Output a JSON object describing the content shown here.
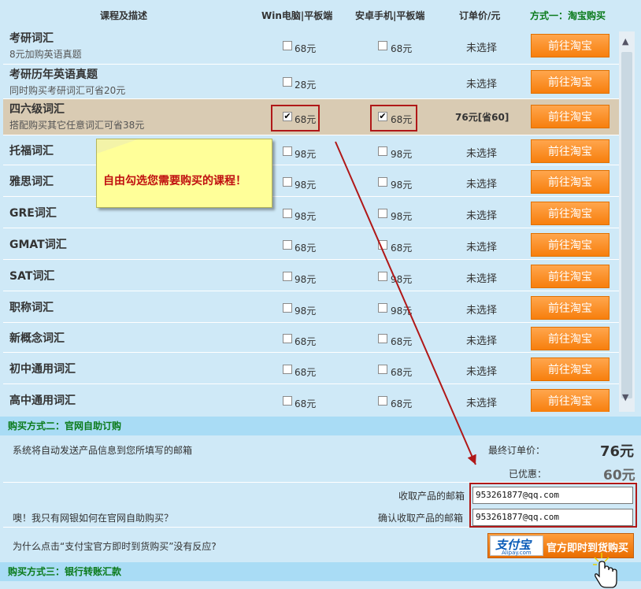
{
  "header": {
    "col_course": "课程及描述",
    "col_win": "Win电脑|平板端",
    "col_android": "安卓手机|平板端",
    "col_price": "订单价/元",
    "col_method": "方式一：淘宝购买"
  },
  "courses": [
    {
      "name": "考研词汇",
      "desc": "8元加购英语真题",
      "win_price": "68元",
      "win_checked": false,
      "android_price": "68元",
      "android_checked": false,
      "order": "未选择",
      "button": "前往淘宝"
    },
    {
      "name": "考研历年英语真题",
      "desc": "同时购买考研词汇可省20元",
      "win_price": "28元",
      "win_checked": false,
      "android_price": "",
      "android_checked": false,
      "order": "未选择",
      "button": "前往淘宝"
    },
    {
      "name": "四六级词汇",
      "desc": "搭配购买其它任意词汇可省38元",
      "win_price": "68元",
      "win_checked": true,
      "android_price": "68元",
      "android_checked": true,
      "order": "76元[省60]",
      "button": "前往淘宝"
    },
    {
      "name": "托福词汇",
      "desc": "",
      "win_price": "98元",
      "win_checked": false,
      "android_price": "98元",
      "android_checked": false,
      "order": "未选择",
      "button": "前往淘宝"
    },
    {
      "name": "雅思词汇",
      "desc": "",
      "win_price": "98元",
      "win_checked": false,
      "android_price": "98元",
      "android_checked": false,
      "order": "未选择",
      "button": "前往淘宝"
    },
    {
      "name": "GRE词汇",
      "desc": "",
      "win_price": "98元",
      "win_checked": false,
      "android_price": "98元",
      "android_checked": false,
      "order": "未选择",
      "button": "前往淘宝"
    },
    {
      "name": "GMAT词汇",
      "desc": "",
      "win_price": "68元",
      "win_checked": false,
      "android_price": "68元",
      "android_checked": false,
      "order": "未选择",
      "button": "前往淘宝"
    },
    {
      "name": "SAT词汇",
      "desc": "",
      "win_price": "98元",
      "win_checked": false,
      "android_price": "98元",
      "android_checked": false,
      "order": "未选择",
      "button": "前往淘宝"
    },
    {
      "name": "职称词汇",
      "desc": "",
      "win_price": "98元",
      "win_checked": false,
      "android_price": "98元",
      "android_checked": false,
      "order": "未选择",
      "button": "前往淘宝"
    },
    {
      "name": "新概念词汇",
      "desc": "",
      "win_price": "68元",
      "win_checked": false,
      "android_price": "68元",
      "android_checked": false,
      "order": "未选择",
      "button": "前往淘宝"
    },
    {
      "name": "初中通用词汇",
      "desc": "",
      "win_price": "68元",
      "win_checked": false,
      "android_price": "68元",
      "android_checked": false,
      "order": "未选择",
      "button": "前往淘宝"
    },
    {
      "name": "高中通用词汇",
      "desc": "",
      "win_price": "68元",
      "win_checked": false,
      "android_price": "68元",
      "android_checked": false,
      "order": "未选择",
      "button": "前往淘宝"
    }
  ],
  "tooltip": "自由勾选您需要购买的课程！",
  "section2": {
    "title": "购买方式二：官网自助订购",
    "auto_send": "系统将自动发送产品信息到您所填写的邮箱",
    "final_price_label": "最终订单价：",
    "final_price": "76元",
    "discount_label": "已优惠：",
    "discount": "60元",
    "email_label": "收取产品的邮箱",
    "email_value": "953261877@qq.com",
    "confirm_label": "确认收取产品的邮箱",
    "confirm_value": "953261877@qq.com",
    "bank_question": "噢！我只有网银如何在官网自助购买？",
    "alipay_question": "为什么点击“支付宝官方即时到货购买”没有反应?",
    "alipay_logo": "支付宝",
    "alipay_logo_sub": "Alipay.com",
    "alipay_button": "官方即时到货购买"
  },
  "section3": {
    "title": "购买方式三：银行转账汇款"
  }
}
